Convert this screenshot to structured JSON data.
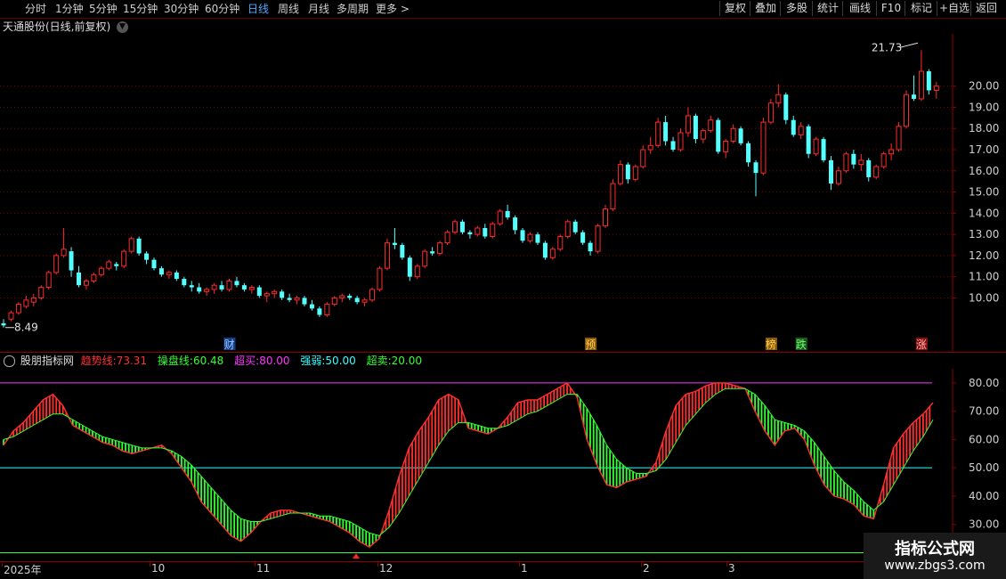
{
  "toolbar": {
    "periods": [
      "分时",
      "1分钟",
      "5分钟",
      "15分钟",
      "30分钟",
      "60分钟",
      "日线",
      "周线",
      "月线",
      "多周期",
      "更多 >"
    ],
    "active": "日线",
    "buttons": [
      "复权",
      "叠加",
      "多股",
      "统计",
      "画线",
      "F10",
      "标记",
      "+自选",
      "返回"
    ]
  },
  "stock": {
    "name_line": "天通股份(日线,前复权)"
  },
  "colors": {
    "up": "#ff2a2a",
    "down": "#54ffff",
    "grid": "#7a0000",
    "trend": "#ff3030",
    "operate": "#33ff33",
    "overbought": "#ff33ff",
    "strong_weak": "#33ffff",
    "oversold": "#33ff33"
  },
  "price_axis": {
    "ticks": [
      "20.00",
      "19.00",
      "18.00",
      "17.00",
      "16.00",
      "15.00",
      "14.00",
      "13.00",
      "12.00",
      "11.00",
      "10.00"
    ],
    "high_label": "21.73",
    "low_label": "8.49",
    "min": 8.0,
    "max": 22.3
  },
  "event_markers": [
    {
      "text": "财",
      "kind": "finance"
    },
    {
      "text": "预",
      "kind": "forecast"
    },
    {
      "text": "榜",
      "kind": "list"
    },
    {
      "text": "跌",
      "kind": "down"
    },
    {
      "text": "涨",
      "kind": "up"
    }
  ],
  "indicator": {
    "name": "股朋指标网",
    "trend_label": "趋势线:",
    "trend_value": "73.31",
    "operate_label": "操盘线:",
    "operate_value": "60.48",
    "overbought_label": "超买:",
    "overbought_value": "80.00",
    "strong_weak_label": "强弱:",
    "strong_weak_value": "50.00",
    "oversold_label": "超卖:",
    "oversold_value": "20.00",
    "ticks": [
      "80.00",
      "70.00",
      "60.00",
      "50.00",
      "40.00",
      "30.00",
      "20.00"
    ],
    "min": 17,
    "max": 85
  },
  "xaxis": {
    "labels": [
      "2025年",
      "10",
      "11",
      "12",
      "1",
      "2",
      "3"
    ]
  },
  "watermark": {
    "title": "指标公式网",
    "url": "www.zbgs3.com"
  },
  "chart_data": [
    {
      "type": "candlestick",
      "title": "天通股份(日线,前复权)",
      "ohlc": [
        [
          8.8,
          9.0,
          8.6,
          8.7
        ],
        [
          9.0,
          9.4,
          8.9,
          9.3
        ],
        [
          9.3,
          9.8,
          9.2,
          9.7
        ],
        [
          9.6,
          10.1,
          9.5,
          9.9
        ],
        [
          9.8,
          10.2,
          9.6,
          10.0
        ],
        [
          10.0,
          10.6,
          9.9,
          10.5
        ],
        [
          10.5,
          11.3,
          10.4,
          11.2
        ],
        [
          11.2,
          12.1,
          11.1,
          12.0
        ],
        [
          12.0,
          13.3,
          11.9,
          12.3
        ],
        [
          12.2,
          12.4,
          11.0,
          11.3
        ],
        [
          11.2,
          11.5,
          10.5,
          10.6
        ],
        [
          10.6,
          10.9,
          10.4,
          10.8
        ],
        [
          10.8,
          11.2,
          10.7,
          11.1
        ],
        [
          11.1,
          11.5,
          11.0,
          11.4
        ],
        [
          11.4,
          11.8,
          11.3,
          11.7
        ],
        [
          11.6,
          11.7,
          11.3,
          11.5
        ],
        [
          11.5,
          12.3,
          11.4,
          12.2
        ],
        [
          12.2,
          12.9,
          12.1,
          12.8
        ],
        [
          12.8,
          12.9,
          12.0,
          12.1
        ],
        [
          12.1,
          12.2,
          11.6,
          11.8
        ],
        [
          11.8,
          11.9,
          11.3,
          11.4
        ],
        [
          11.4,
          11.5,
          11.0,
          11.1
        ],
        [
          11.1,
          11.3,
          10.9,
          11.2
        ],
        [
          11.2,
          11.3,
          10.8,
          10.9
        ],
        [
          10.9,
          11.0,
          10.5,
          10.6
        ],
        [
          10.6,
          10.8,
          10.3,
          10.5
        ],
        [
          10.5,
          10.7,
          10.2,
          10.3
        ],
        [
          10.3,
          10.5,
          10.1,
          10.4
        ],
        [
          10.4,
          10.7,
          10.2,
          10.6
        ],
        [
          10.6,
          10.8,
          10.3,
          10.4
        ],
        [
          10.4,
          10.9,
          10.3,
          10.8
        ],
        [
          10.8,
          11.0,
          10.5,
          10.6
        ],
        [
          10.6,
          10.7,
          10.3,
          10.4
        ],
        [
          10.4,
          10.6,
          10.2,
          10.5
        ],
        [
          10.5,
          10.6,
          10.0,
          10.1
        ],
        [
          10.1,
          10.3,
          9.8,
          10.2
        ],
        [
          10.2,
          10.4,
          10.0,
          10.3
        ],
        [
          10.3,
          10.4,
          9.9,
          10.0
        ],
        [
          10.0,
          10.2,
          9.8,
          9.9
        ],
        [
          9.9,
          10.1,
          9.7,
          10.0
        ],
        [
          10.0,
          10.1,
          9.6,
          9.7
        ],
        [
          9.7,
          9.9,
          9.4,
          9.5
        ],
        [
          9.5,
          9.6,
          9.1,
          9.2
        ],
        [
          9.2,
          9.8,
          9.1,
          9.7
        ],
        [
          9.7,
          10.1,
          9.6,
          10.0
        ],
        [
          10.0,
          10.2,
          9.8,
          10.1
        ],
        [
          10.1,
          10.2,
          9.9,
          10.0
        ],
        [
          10.0,
          10.1,
          9.7,
          9.8
        ],
        [
          9.8,
          10.0,
          9.6,
          9.9
        ],
        [
          9.9,
          10.5,
          9.8,
          10.4
        ],
        [
          10.4,
          11.5,
          10.3,
          11.4
        ],
        [
          11.4,
          12.8,
          11.3,
          12.6
        ],
        [
          12.6,
          13.3,
          12.3,
          12.5
        ],
        [
          12.5,
          12.6,
          11.8,
          11.9
        ],
        [
          11.9,
          12.0,
          10.8,
          11.0
        ],
        [
          11.0,
          11.6,
          10.9,
          11.5
        ],
        [
          11.5,
          12.3,
          11.4,
          12.2
        ],
        [
          12.2,
          12.4,
          12.0,
          12.1
        ],
        [
          12.1,
          12.7,
          12.0,
          12.6
        ],
        [
          12.6,
          13.2,
          12.5,
          13.1
        ],
        [
          13.1,
          13.7,
          13.0,
          13.6
        ],
        [
          13.6,
          13.7,
          13.0,
          13.1
        ],
        [
          13.1,
          13.2,
          12.8,
          13.0
        ],
        [
          13.0,
          13.4,
          12.9,
          13.3
        ],
        [
          13.3,
          13.5,
          12.8,
          12.9
        ],
        [
          12.9,
          13.6,
          12.8,
          13.5
        ],
        [
          13.5,
          14.2,
          13.4,
          14.1
        ],
        [
          14.1,
          14.4,
          13.7,
          13.8
        ],
        [
          13.8,
          13.9,
          13.0,
          13.2
        ],
        [
          13.2,
          13.3,
          12.6,
          12.7
        ],
        [
          12.7,
          13.1,
          12.6,
          13.0
        ],
        [
          13.0,
          13.1,
          12.5,
          12.6
        ],
        [
          12.6,
          12.7,
          11.8,
          11.9
        ],
        [
          11.9,
          12.4,
          11.8,
          12.3
        ],
        [
          12.3,
          13.0,
          12.2,
          12.9
        ],
        [
          12.9,
          13.7,
          12.8,
          13.6
        ],
        [
          13.6,
          13.7,
          13.0,
          13.1
        ],
        [
          13.1,
          13.2,
          12.5,
          12.6
        ],
        [
          12.6,
          12.7,
          12.0,
          12.2
        ],
        [
          12.2,
          13.5,
          12.1,
          13.4
        ],
        [
          13.4,
          14.4,
          13.3,
          14.2
        ],
        [
          14.2,
          15.6,
          14.1,
          15.4
        ],
        [
          15.4,
          16.5,
          15.3,
          16.3
        ],
        [
          16.3,
          16.4,
          15.4,
          15.6
        ],
        [
          15.6,
          16.3,
          15.5,
          16.2
        ],
        [
          16.2,
          17.2,
          16.1,
          17.0
        ],
        [
          17.0,
          17.6,
          16.8,
          17.2
        ],
        [
          17.2,
          18.5,
          17.1,
          18.3
        ],
        [
          18.3,
          18.6,
          17.2,
          17.4
        ],
        [
          17.4,
          17.6,
          16.9,
          17.0
        ],
        [
          17.0,
          18.0,
          16.9,
          17.8
        ],
        [
          17.8,
          19.0,
          17.6,
          18.6
        ],
        [
          18.6,
          18.7,
          17.3,
          17.5
        ],
        [
          17.5,
          18.0,
          17.3,
          17.9
        ],
        [
          17.9,
          18.6,
          17.8,
          18.4
        ],
        [
          18.4,
          18.5,
          16.8,
          16.9
        ],
        [
          16.9,
          17.5,
          16.6,
          17.4
        ],
        [
          17.4,
          18.2,
          17.3,
          18.0
        ],
        [
          18.0,
          18.1,
          17.2,
          17.3
        ],
        [
          17.3,
          17.4,
          16.2,
          16.4
        ],
        [
          16.4,
          16.5,
          14.8,
          15.9
        ],
        [
          15.9,
          18.5,
          15.8,
          18.3
        ],
        [
          18.3,
          19.4,
          18.2,
          19.2
        ],
        [
          19.2,
          20.1,
          19.0,
          19.6
        ],
        [
          19.6,
          19.7,
          18.2,
          18.4
        ],
        [
          18.4,
          18.6,
          17.6,
          17.7
        ],
        [
          17.7,
          18.3,
          17.5,
          18.1
        ],
        [
          18.1,
          18.2,
          16.6,
          16.8
        ],
        [
          16.8,
          17.6,
          16.7,
          17.5
        ],
        [
          17.5,
          17.6,
          16.4,
          16.5
        ],
        [
          16.5,
          16.7,
          15.1,
          15.4
        ],
        [
          15.4,
          16.2,
          15.3,
          16.0
        ],
        [
          16.0,
          16.9,
          15.9,
          16.8
        ],
        [
          16.8,
          17.0,
          16.1,
          16.3
        ],
        [
          16.3,
          16.8,
          16.0,
          16.5
        ],
        [
          16.5,
          16.6,
          15.5,
          15.7
        ],
        [
          15.7,
          16.3,
          15.6,
          16.2
        ],
        [
          16.2,
          16.9,
          16.1,
          16.8
        ],
        [
          16.8,
          17.3,
          16.5,
          17.0
        ],
        [
          17.0,
          18.3,
          16.9,
          18.1
        ],
        [
          18.1,
          19.8,
          18.0,
          19.6
        ],
        [
          19.6,
          20.5,
          19.3,
          19.4
        ],
        [
          19.4,
          21.7,
          19.3,
          20.7
        ],
        [
          20.7,
          20.8,
          19.6,
          19.8
        ],
        [
          19.8,
          20.2,
          19.4,
          20.0
        ]
      ]
    },
    {
      "type": "line",
      "title": "股朋指标网",
      "series": [
        {
          "name": "趋势线",
          "values": [
            58,
            63,
            66,
            70,
            74,
            76,
            72,
            65,
            63,
            61,
            59,
            58,
            56,
            55,
            56,
            57,
            58,
            55,
            50,
            45,
            38,
            34,
            30,
            26,
            24,
            27,
            31,
            34,
            35,
            35,
            34,
            33,
            32,
            31,
            29,
            27,
            24,
            22,
            25,
            35,
            47,
            57,
            63,
            68,
            74,
            76,
            74,
            64,
            63,
            62,
            64,
            68,
            73,
            74,
            74,
            76,
            78,
            80,
            75,
            60,
            51,
            44,
            43,
            45,
            46,
            47,
            52,
            63,
            72,
            76,
            77,
            79,
            80,
            80,
            79,
            78,
            70,
            63,
            58,
            63,
            64,
            60,
            51,
            44,
            40,
            39,
            37,
            33,
            32,
            44,
            57,
            62,
            66,
            69,
            73
          ]
        },
        {
          "name": "操盘线",
          "values": [
            60,
            61,
            63,
            65,
            67,
            69,
            69,
            67,
            65,
            63,
            61,
            60,
            59,
            58,
            57,
            57,
            57,
            56,
            54,
            51,
            47,
            43,
            39,
            35,
            32,
            31,
            31,
            32,
            33,
            34,
            34,
            34,
            33,
            33,
            32,
            31,
            29,
            27,
            26,
            29,
            34,
            40,
            46,
            52,
            58,
            63,
            66,
            66,
            65,
            64,
            64,
            65,
            67,
            69,
            70,
            72,
            74,
            76,
            76,
            71,
            65,
            58,
            53,
            50,
            48,
            48,
            49,
            53,
            59,
            65,
            69,
            73,
            76,
            78,
            78,
            78,
            76,
            72,
            67,
            66,
            65,
            63,
            59,
            54,
            49,
            45,
            42,
            38,
            35,
            38,
            44,
            50,
            56,
            61,
            67
          ]
        }
      ],
      "lines": {
        "超买": 80,
        "强弱": 50,
        "超卖": 20
      },
      "ylim": [
        17,
        85
      ]
    }
  ]
}
